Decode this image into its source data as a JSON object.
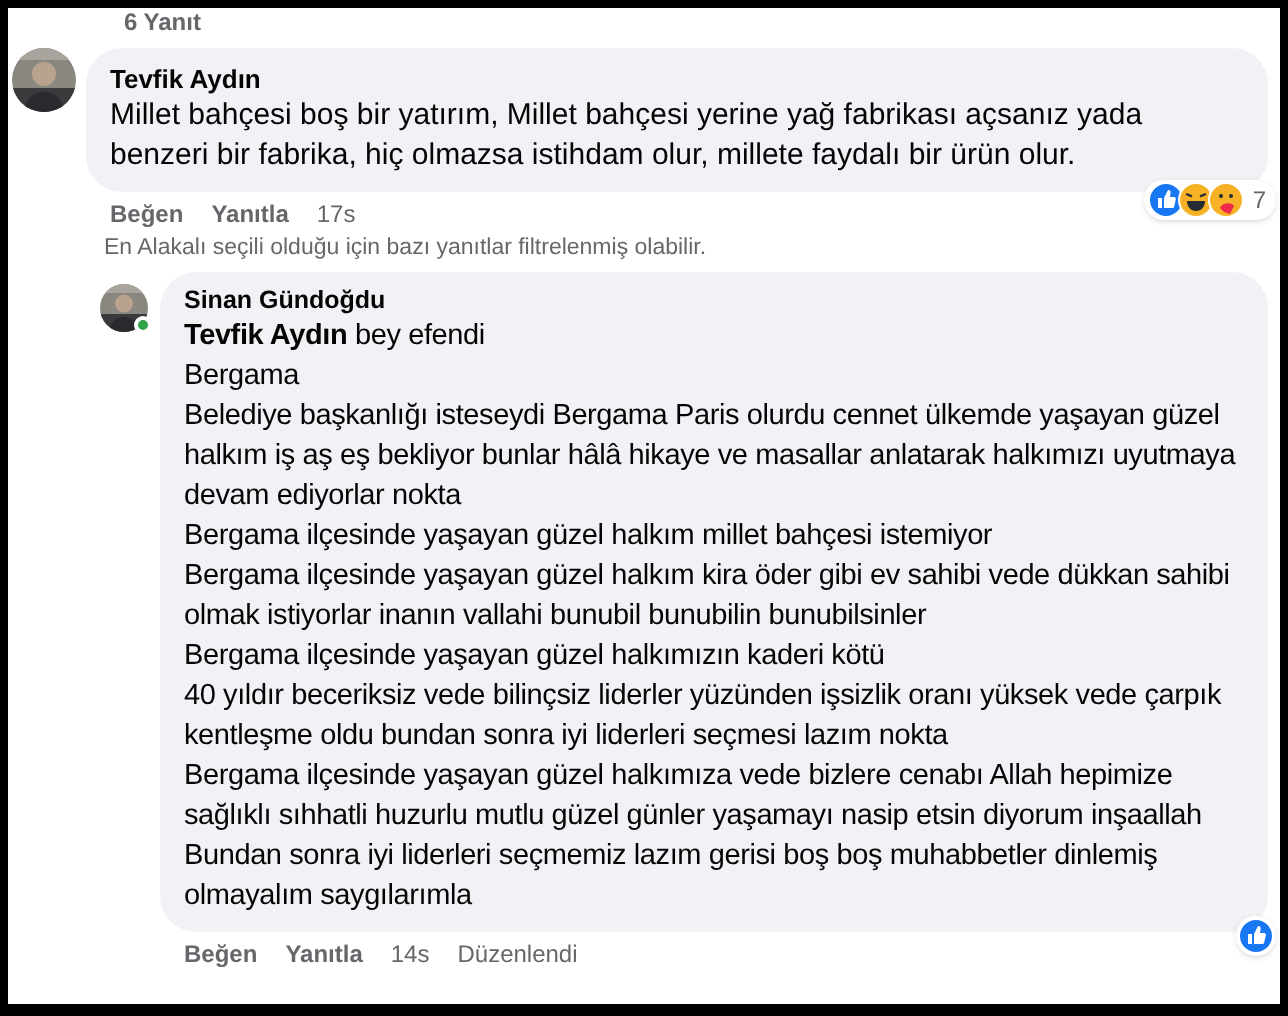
{
  "replies_toggle": {
    "label": "6 Yanıt"
  },
  "comment": {
    "author": "Tevfik Aydın",
    "text": "Millet bahçesi boş bir yatırım, Millet bahçesi yerine yağ fabrikası açsanız yada benzeri bir fabrika, hiç olmazsa istihdam olur, millete faydalı bir ürün olur.",
    "actions": [
      "Beğen",
      "Yanıtla"
    ],
    "time": "17s",
    "reactions": [
      {
        "kind": "like"
      },
      {
        "kind": "haha"
      },
      {
        "kind": "care"
      }
    ],
    "reaction_count": "7"
  },
  "filter_note": "En Alakalı seçili olduğu için bazı yanıtlar filtrelenmiş olabilir.",
  "reply": {
    "author": "Sinan Gündoğdu",
    "online": true,
    "mention": "Tevfik Aydın",
    "mention_rest": " bey efendi",
    "paragraphs": [
      "Bergama",
      "Belediye başkanlığı isteseydi Bergama Paris olurdu cennet ülkemde yaşayan güzel halkım iş aş eş bekliyor bunlar hâlâ hikaye ve masallar anlatarak halkımızı uyutmaya devam ediyorlar nokta",
      "Bergama ilçesinde yaşayan güzel halkım millet bahçesi istemiyor",
      "Bergama ilçesinde yaşayan güzel halkım kira öder gibi ev sahibi vede dükkan sahibi olmak istiyorlar inanın vallahi bunubil bunubilin bunubilsinler",
      "Bergama ilçesinde yaşayan güzel halkımızın kaderi kötü",
      "40 yıldır beceriksiz vede bilinçsiz liderler yüzünden işsizlik oranı yüksek vede çarpık kentleşme oldu bundan sonra iyi liderleri seçmesi lazım nokta",
      "Bergama ilçesinde yaşayan güzel halkımıza vede bizlere cenabı Allah hepimize sağlıklı sıhhatli huzurlu mutlu güzel günler yaşamayı nasip etsin diyorum inşaallah",
      "Bundan sonra iyi liderleri seçmemiz lazım gerisi boş boş muhabbetler dinlemiş olmayalım saygılarımla"
    ],
    "actions": [
      "Beğen",
      "Yanıtla"
    ],
    "time": "14s",
    "edited": "Düzenlendi",
    "reactions": [
      {
        "kind": "like"
      }
    ]
  }
}
